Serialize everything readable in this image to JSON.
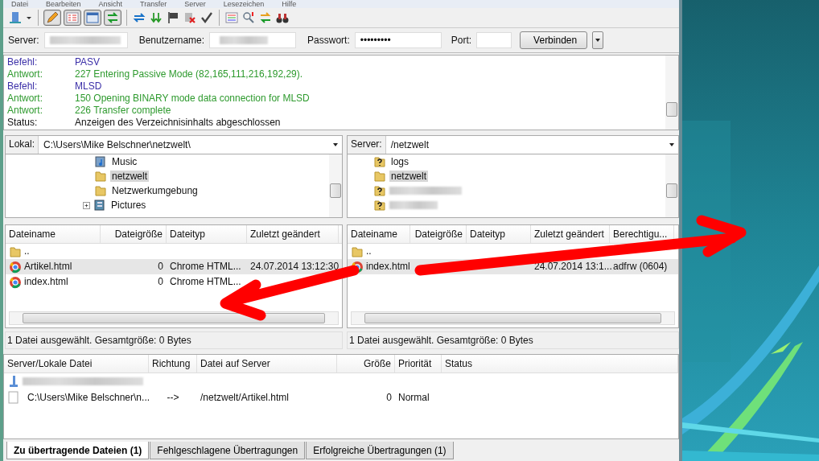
{
  "menu": [
    "Datei",
    "Bearbeiten",
    "Ansicht",
    "Transfer",
    "Server",
    "Lesezeichen",
    "Hilfe"
  ],
  "toolbar_toggles": [
    {
      "selected": true
    },
    {
      "selected": true
    },
    {
      "selected": true
    },
    {
      "selected": true
    }
  ],
  "quickconnect": {
    "server_label": "Server:",
    "server_redacted": true,
    "user_label": "Benutzername:",
    "user_redacted": true,
    "password_label": "Passwort:",
    "password_value": "•••••••••",
    "port_label": "Port:",
    "connect_button": "Verbinden"
  },
  "log": [
    {
      "kind": "command",
      "label": "Befehl:",
      "text": "PASV"
    },
    {
      "kind": "response",
      "label": "Antwort:",
      "text": "227 Entering Passive Mode (82,165,111,216,192,29)."
    },
    {
      "kind": "command",
      "label": "Befehl:",
      "text": "MLSD"
    },
    {
      "kind": "response",
      "label": "Antwort:",
      "text": "150 Opening BINARY mode data connection for MLSD"
    },
    {
      "kind": "response",
      "label": "Antwort:",
      "text": "226 Transfer complete"
    },
    {
      "kind": "status",
      "label": "Status:",
      "text": "Anzeigen des Verzeichnisinhalts abgeschlossen"
    }
  ],
  "panels": [
    {
      "label": "Lokal:",
      "path": "C:\\Users\\Mike Belschner\\netzwelt\\",
      "tree": [
        {
          "kind": "music",
          "name": "Music",
          "selected": false,
          "collapsed": false
        },
        {
          "kind": "folder",
          "name": "netzwelt",
          "selected": true,
          "collapsed": false
        },
        {
          "kind": "folder",
          "name": "Netzwerkumgebung",
          "selected": false,
          "collapsed": false
        },
        {
          "kind": "pictures",
          "name": "Pictures",
          "selected": false,
          "collapsed": true
        }
      ],
      "columns": [
        "Dateiname",
        "Dateigröße",
        "Dateityp",
        "Zuletzt geändert"
      ],
      "rows": [
        {
          "kind": "parent",
          "name": "..",
          "selected": false
        },
        {
          "kind": "html",
          "name": "Artikel.html",
          "size": "0",
          "type": "Chrome HTML...",
          "modified": "24.07.2014 13:12:30",
          "selected": true
        },
        {
          "kind": "html",
          "name": "index.html",
          "size": "0",
          "type": "Chrome HTML...",
          "selected": false
        }
      ],
      "status": "1 Datei ausgewählt. Gesamtgröße: 0 Bytes"
    },
    {
      "label": "Server:",
      "path": "/netzwelt",
      "tree": [
        {
          "kind": "unknown",
          "name": "logs",
          "selected": false,
          "collapsed": false
        },
        {
          "kind": "folder",
          "name": "netzwelt",
          "selected": true,
          "collapsed": false
        },
        {
          "kind": "unknown",
          "redacted": true,
          "selected": false,
          "collapsed": false
        },
        {
          "kind": "unknown",
          "redacted": true,
          "selected": false,
          "collapsed": false
        }
      ],
      "columns": [
        "Dateiname",
        "Dateigröße",
        "Dateityp",
        "Zuletzt geändert",
        "Berechtigu..."
      ],
      "rows": [
        {
          "kind": "parent",
          "name": "..",
          "selected": false
        },
        {
          "kind": "html",
          "name": "index.html",
          "modified": "24.07.2014 13:1...",
          "permissions": "adfrw (0604)",
          "selected": true
        }
      ],
      "status": "1 Datei ausgewählt. Gesamtgröße: 0 Bytes"
    }
  ],
  "queue": {
    "columns": [
      "Server/Lokale Datei",
      "Richtung",
      "Datei auf Server",
      "Größe",
      "Priorität",
      "Status"
    ],
    "rows": [
      {
        "kind": "server",
        "redacted": true
      },
      {
        "kind": "file",
        "local": "C:\\Users\\Mike Belschner\\n...",
        "direction": "-->",
        "remote": "/netzwelt/Artikel.html",
        "size": "0",
        "priority": "Normal"
      }
    ]
  },
  "tabs": [
    {
      "label": "Zu übertragende Dateien (1)",
      "selected": true
    },
    {
      "label": "Fehlgeschlagene Übertragungen",
      "selected": false
    },
    {
      "label": "Erfolgreiche Übertragungen (1)",
      "selected": false
    }
  ]
}
